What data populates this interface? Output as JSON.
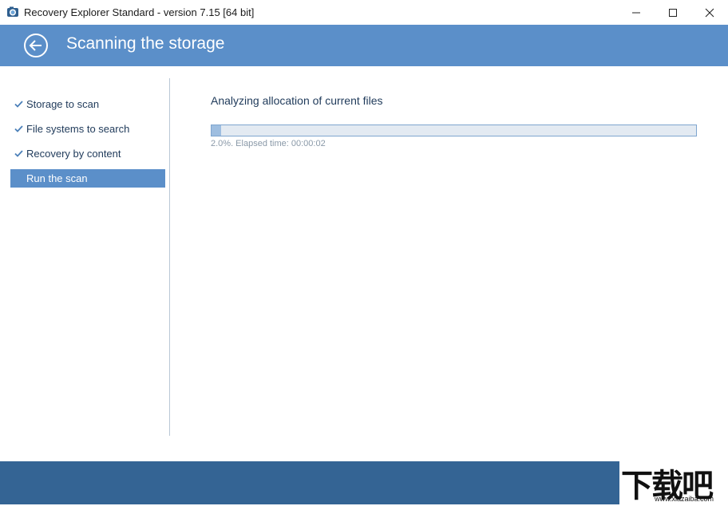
{
  "window": {
    "title": "Recovery Explorer Standard - version 7.15 [64 bit]",
    "icon": "camera-lens-icon"
  },
  "header": {
    "title": "Scanning the storage",
    "back_icon": "back-arrow-icon"
  },
  "sidebar": {
    "steps": [
      {
        "label": "Storage to scan",
        "state": "done"
      },
      {
        "label": "File systems to search",
        "state": "done"
      },
      {
        "label": "Recovery by content",
        "state": "done"
      },
      {
        "label": "Run the scan",
        "state": "active"
      }
    ]
  },
  "main": {
    "status_heading": "Analyzing allocation of current files",
    "progress_fraction": 0.02,
    "progress_text": "2.0%. Elapsed time: 00:00:02"
  },
  "watermark": {
    "main": "下载吧",
    "sub": "www.xiazaiba.com"
  },
  "colors": {
    "accent": "#5b8fc9",
    "footer": "#346494",
    "text": "#1f3a5a"
  }
}
